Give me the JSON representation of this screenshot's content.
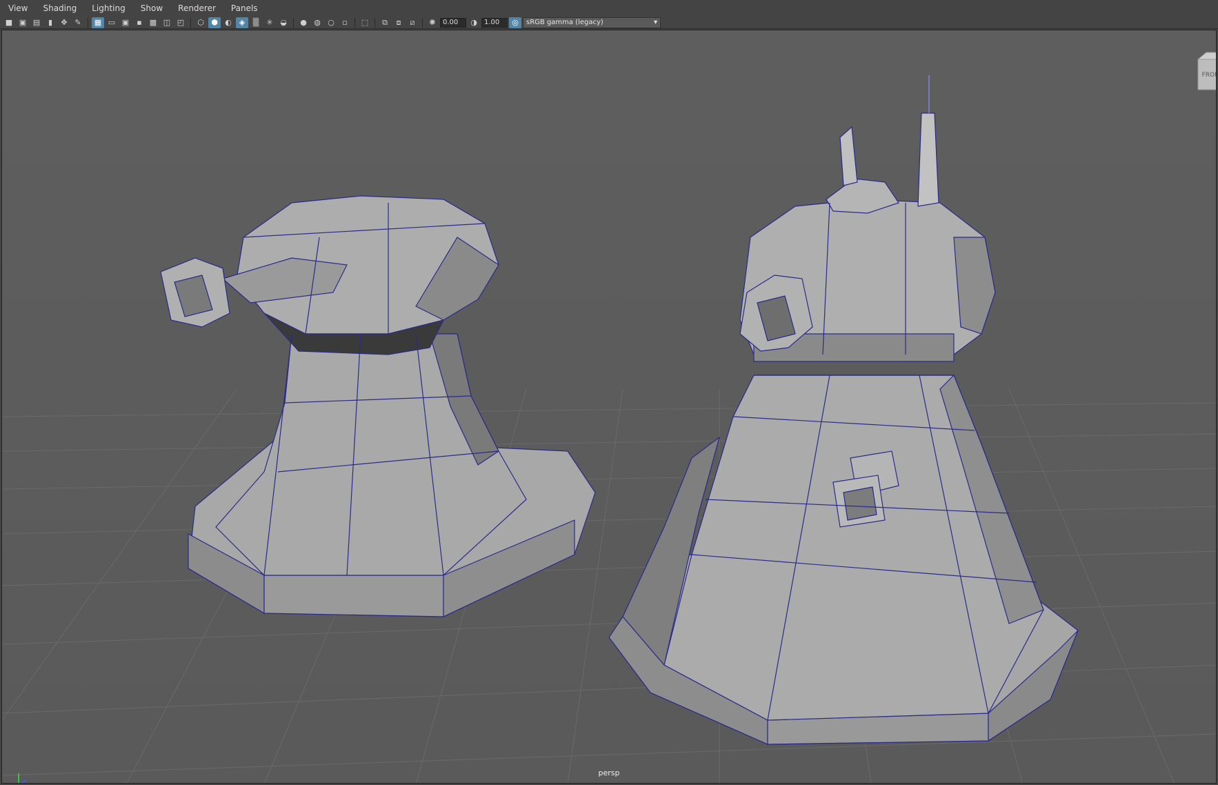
{
  "menu": [
    "View",
    "Shading",
    "Lighting",
    "Show",
    "Renderer",
    "Panels"
  ],
  "toolbar": {
    "exposure": "0.00",
    "gamma": "1.00",
    "color_space": "sRGB gamma (legacy)",
    "icons": [
      "camera-icon",
      "camera-attr-icon",
      "bookmark-icon",
      "image-plane-icon",
      "2d-pan-icon",
      "grease-pencil-icon",
      "grid-icon",
      "film-gate-icon",
      "resolution-gate-icon",
      "gate-mask-icon",
      "field-chart-icon",
      "safe-action-icon",
      "wireframe-icon",
      "smooth-shade-icon",
      "default-material-icon",
      "wireframe-on-shaded-icon",
      "xray-icon",
      "lights-icon",
      "shadows-icon",
      "ambient-occlusion-icon",
      "motion-blur-icon",
      "multisample-icon",
      "depth-of-field-icon",
      "isolate-select-icon",
      "xray-joints-icon",
      "xray-active-icon",
      "backface-icon",
      "exposure-icon",
      "gamma-icon",
      "color-management-icon"
    ],
    "accent_color": "#5285a6"
  },
  "viewport": {
    "camera": "persp",
    "viewcube_label": "FRONT",
    "background_color": "#5e5e5e",
    "wire_color": "#2a2a8a"
  }
}
